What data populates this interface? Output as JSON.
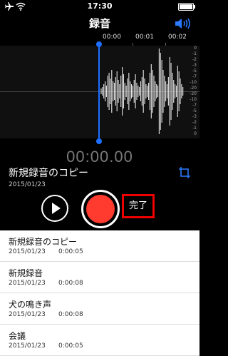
{
  "status_bar": {
    "time": "17:30"
  },
  "nav": {
    "title": "録音"
  },
  "timeline": {
    "labels": [
      "00:00",
      "00:01",
      "00:02"
    ]
  },
  "scale": [
    "0",
    "-1",
    "-2",
    "-3",
    "-5",
    "-7",
    "-10",
    "-20",
    "-20",
    "-10",
    "-7",
    "-5",
    "-3",
    "-2",
    "-1",
    "0"
  ],
  "timer": "00:00.00",
  "current": {
    "name": "新規録音のコピー",
    "date": "2015/01/23"
  },
  "controls": {
    "done_label": "完了"
  },
  "recordings": [
    {
      "name": "新規録音のコピー",
      "date": "2015/01/23",
      "duration": "0:00:05"
    },
    {
      "name": "新規録音",
      "date": "2015/01/23",
      "duration": "0:00:08"
    },
    {
      "name": "犬の鳴き声",
      "date": "2015/01/23",
      "duration": "0:00:08"
    },
    {
      "name": "会議",
      "date": "2015/01/23",
      "duration": "0:00:05"
    }
  ],
  "colors": {
    "accent": "#1e6fff",
    "record": "#ff3b30",
    "highlight": "#e00000"
  },
  "icons": [
    "airplane-icon",
    "wifi-icon",
    "battery-icon",
    "speaker-icon",
    "crop-icon",
    "play-icon",
    "record-icon"
  ]
}
